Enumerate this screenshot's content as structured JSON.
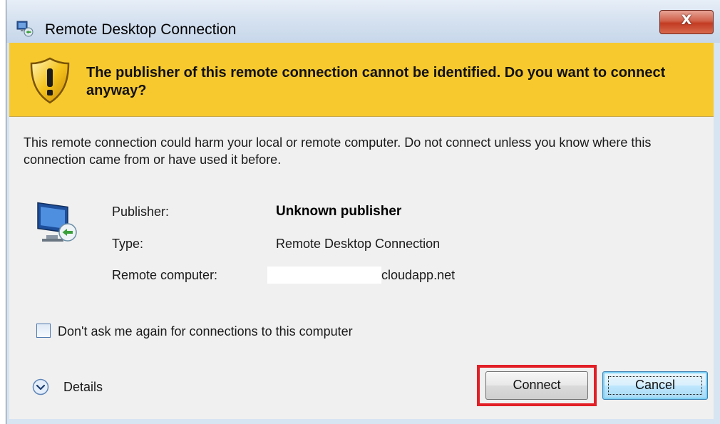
{
  "window": {
    "title": "Remote Desktop Connection",
    "close_glyph": "X"
  },
  "banner": {
    "message": "The publisher of this remote connection cannot be identified. Do you want to connect anyway?",
    "icon": "warning-shield-icon",
    "color": "#f7c92f"
  },
  "body": {
    "message": "This remote connection could harm your local or remote computer. Do not connect unless you know where this connection came from or have used it before."
  },
  "info": {
    "icon": "remote-computer-icon",
    "rows": [
      {
        "label": "Publisher:",
        "value": "Unknown publisher"
      },
      {
        "label": "Type:",
        "value": "Remote Desktop Connection"
      },
      {
        "label": "Remote computer:",
        "value": "cloudapp.net"
      }
    ]
  },
  "options": {
    "dont_ask_label": "Don't ask me again for connections to this computer",
    "dont_ask_checked": false
  },
  "footer": {
    "details_label": "Details",
    "connect_label": "Connect",
    "cancel_label": "Cancel",
    "highlight_color": "#e21f26"
  }
}
